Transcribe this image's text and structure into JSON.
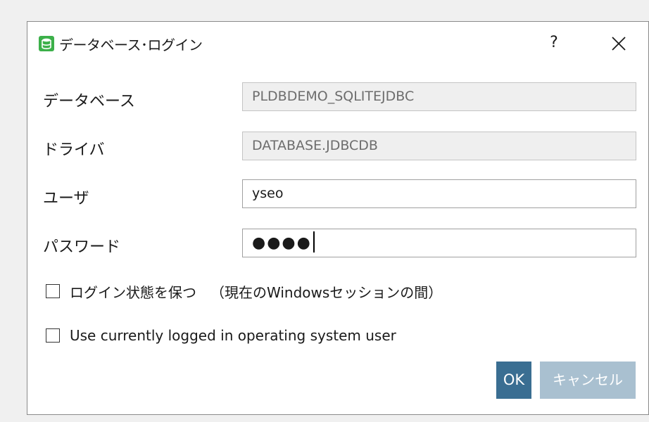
{
  "window": {
    "title": "データベース･ログイン",
    "help_label": "?",
    "app_icon": "database-icon",
    "close_icon": "close-icon"
  },
  "form": {
    "database_label": "データベース",
    "database_value": "PLDBDEMO_SQLITEJDBC",
    "driver_label": "ドライバ",
    "driver_value": "DATABASE.JDBCDB",
    "user_label": "ユーザ",
    "user_value": "yseo",
    "password_label": "パスワード",
    "password_mask": "●●●●"
  },
  "options": {
    "keep_login_label": "ログイン状態を保つ",
    "keep_login_note": "（現在のWindowsセッションの間）",
    "keep_login_checked": false,
    "use_os_user_label": "Use currently logged in operating system user",
    "use_os_user_checked": false
  },
  "buttons": {
    "ok_label": "OK",
    "cancel_label": "キャンセル"
  },
  "colors": {
    "ok_button": "#3a6e92",
    "cancel_button": "#a9c0d0",
    "app_icon": "#3cb04a"
  }
}
